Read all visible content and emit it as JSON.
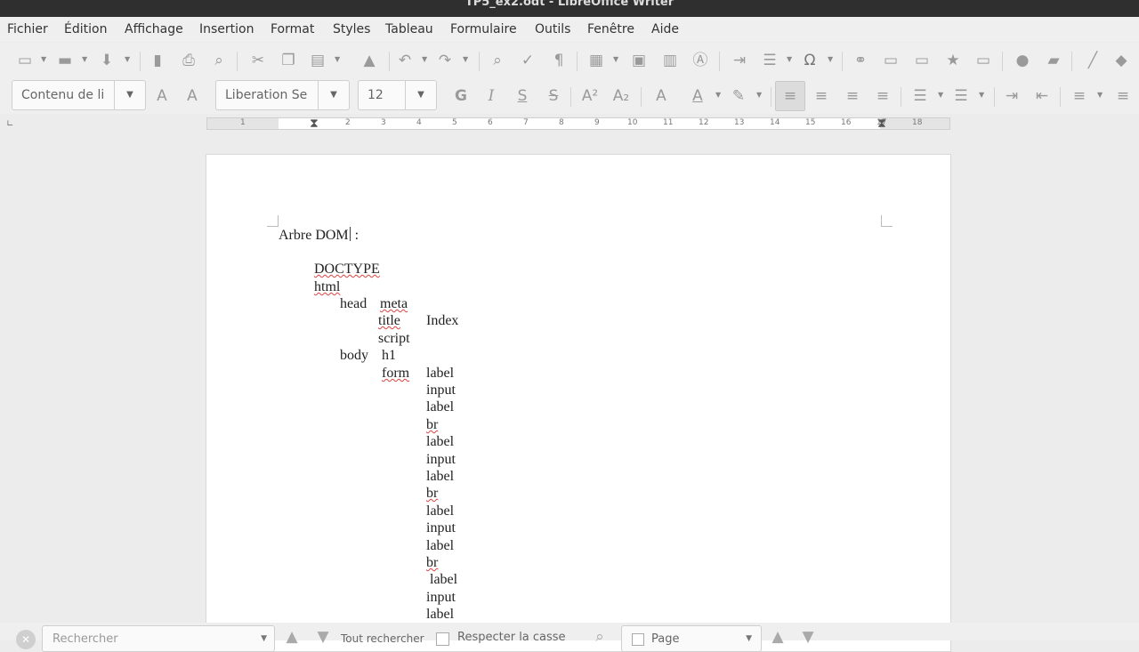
{
  "window": {
    "title": "TP5_ex2.odt - LibreOffice Writer"
  },
  "menu": [
    "Fichier",
    "Édition",
    "Affichage",
    "Insertion",
    "Format",
    "Styles",
    "Tableau",
    "Formulaire",
    "Outils",
    "Fenêtre",
    "Aide"
  ],
  "formatting": {
    "paragraph_style": "Contenu de li",
    "font_name": "Liberation Se",
    "font_size": "12"
  },
  "ruler": {
    "numbers": [
      "1",
      "2",
      "3",
      "4",
      "5",
      "6",
      "7",
      "8",
      "9",
      "10",
      "11",
      "12",
      "13",
      "14",
      "15",
      "16",
      "17",
      "18"
    ]
  },
  "document": {
    "heading": "Arbre DOM",
    "heading_suffix": " :",
    "tree": {
      "doctype": "DOCTYPE",
      "html": "html",
      "head": "head",
      "meta": "meta",
      "title": "title",
      "title_text": "Index",
      "script": "script",
      "body": "body",
      "h1": "h1",
      "form": "form",
      "form_children": [
        "label",
        "input",
        "label",
        "br",
        "label",
        "input",
        "label",
        "br",
        "label",
        "input",
        "label",
        "br",
        "label",
        "input",
        "label"
      ]
    }
  },
  "findbar": {
    "search_placeholder": "Rechercher",
    "find_all": "Tout rechercher",
    "match_case": "Respecter la casse",
    "scope": "Page"
  }
}
